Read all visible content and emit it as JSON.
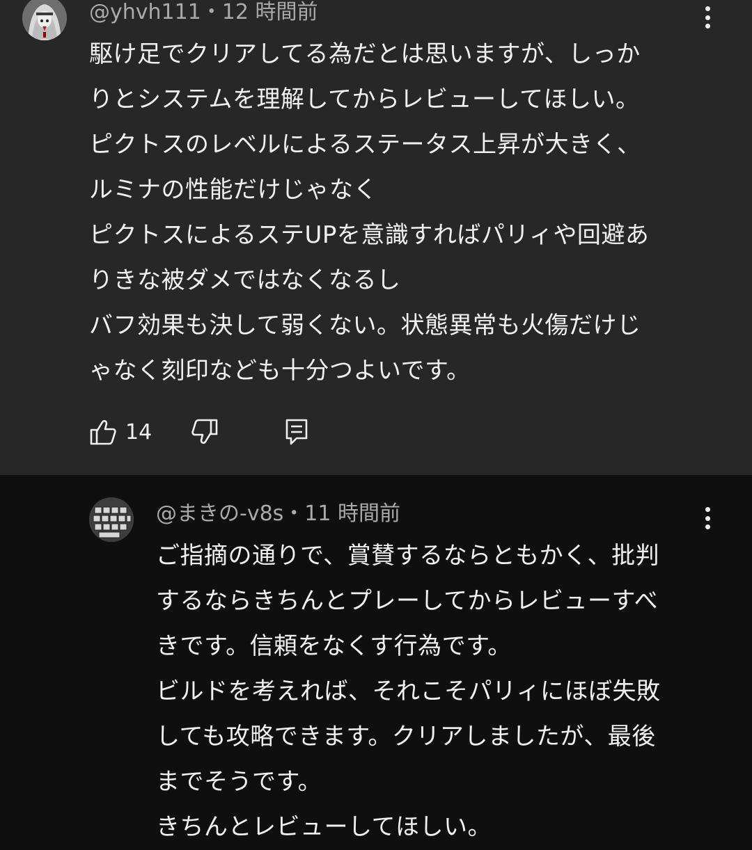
{
  "comments": [
    {
      "author": "@yhvh111",
      "separator": "・",
      "time": "12 時間前",
      "lines": [
        "駆け足でクリアしてる為だとは思いますが、しっか",
        "りとシステムを理解してからレビューしてほしい。",
        "ピクトスのレベルによるステータス上昇が大きく、",
        "ルミナの性能だけじゃなく",
        "ピクトスによるステUPを意識すればパリィや回避あ",
        "りきな被ダメではなくなるし",
        "バフ効果も決して弱くない。状態異常も火傷だけじ",
        "ゃなく刻印なども十分つよいです。"
      ],
      "likes": "14",
      "icons": {
        "menu": "more-vert-icon",
        "like": "thumb-up-icon",
        "dislike": "thumb-down-icon",
        "reply": "reply-comment-icon"
      }
    },
    {
      "author": "@まきの-v8s",
      "separator": "・",
      "time": "11 時間前",
      "lines": [
        "ご指摘の通りで、賞賛するならともかく、批判",
        "するならきちんとプレーしてからレビューすべ",
        "きです。信頼をなくす行為です。",
        "ビルドを考えれば、それこそパリィにほぼ失敗",
        "しても攻略できます。クリアしましたが、最後",
        "までそうです。",
        "きちんとレビューしてほしい。"
      ],
      "icons": {
        "menu": "more-vert-icon"
      }
    }
  ],
  "colors": {
    "top_comment_bg": "#272727",
    "reply_bg": "#0f0f0f",
    "text": "#f1f1f1",
    "meta_text": "#aaaaaa"
  }
}
